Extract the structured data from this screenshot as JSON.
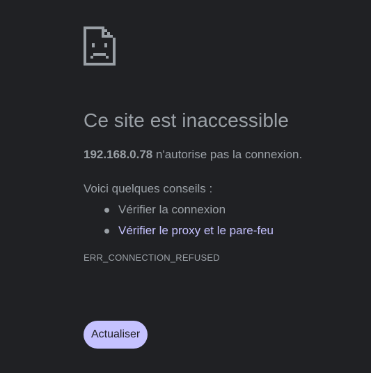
{
  "error_page": {
    "icon": "sad-document-icon",
    "title": "Ce site est inaccessible",
    "host": "192.168.0.78",
    "summary_rest": " n'autorise pas la connexion.",
    "suggestions_intro": "Voici quelques conseils :",
    "suggestions": [
      {
        "label": "Vérifier la connexion",
        "is_link": false
      },
      {
        "label": "Vérifier le proxy et le pare-feu",
        "is_link": true
      }
    ],
    "error_code": "ERR_CONNECTION_REFUSED",
    "reload_label": "Actualiser"
  },
  "colors": {
    "background": "#202124",
    "text": "#9aa0a6",
    "accent": "#c5c2ff",
    "button_text": "#202124"
  }
}
